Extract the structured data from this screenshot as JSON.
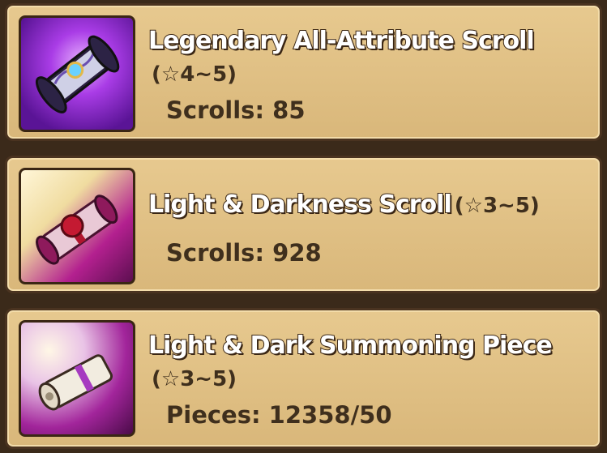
{
  "items": [
    {
      "title": "Legendary All-Attribute Scroll",
      "stars": "(☆4~5)",
      "count": "Scrolls: 85",
      "icon": "legendary-scroll-icon",
      "bg": "#9a2fd6"
    },
    {
      "title": "Light & Darkness Scroll",
      "stars": "(☆3~5)",
      "count": "Scrolls: 928",
      "icon": "light-dark-scroll-icon",
      "bg": "#b3208f"
    },
    {
      "title": "Light & Dark Summoning Piece",
      "stars": "(☆3~5)",
      "count": "Pieces: 12358/50",
      "icon": "summoning-piece-icon",
      "bg": "#a2259b"
    }
  ]
}
